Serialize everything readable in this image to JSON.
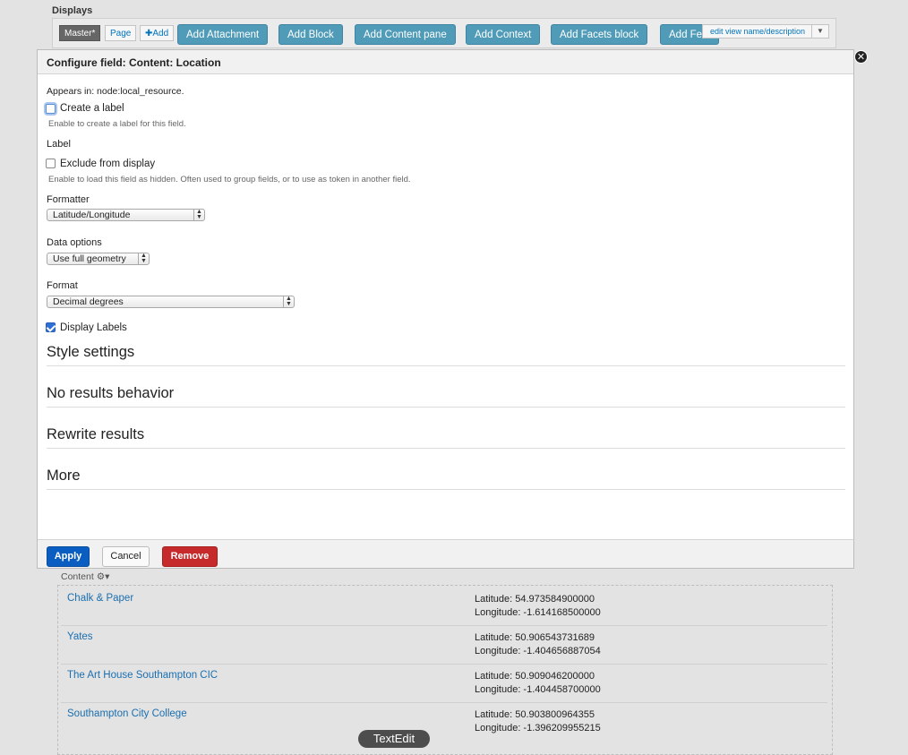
{
  "background": {
    "displays_title": "Displays",
    "tabs": [
      "Master*",
      "Page",
      "✚Add"
    ],
    "add_buttons": [
      "Add Attachment",
      "Add Block",
      "Add Content pane",
      "Add Context",
      "Add Facets block",
      "Add Fe"
    ],
    "edit_view_label": "edit view name/description",
    "content_label": "Content ⚙▾",
    "results": [
      {
        "name": "Chalk & Paper",
        "latitude": "Latitude: 54.973584900000",
        "longitude": "Longitude: -1.614168500000"
      },
      {
        "name": "Yates",
        "latitude": "Latitude: 50.906543731689",
        "longitude": "Longitude: -1.404656887054"
      },
      {
        "name": "The Art House Southampton CIC",
        "latitude": "Latitude: 50.909046200000",
        "longitude": "Longitude: -1.404458700000"
      },
      {
        "name": "Southampton City College",
        "latitude": "Latitude: 50.903800964355",
        "longitude": "Longitude: -1.396209955215"
      }
    ],
    "dock_label": "TextEdit"
  },
  "modal": {
    "title": "Configure field: Content: Location",
    "appears_in": "Appears in: node:local_resource.",
    "create_label": {
      "label": "Create a label",
      "checked": false,
      "description": "Enable to create a label for this field."
    },
    "label_heading": "Label",
    "exclude": {
      "label": "Exclude from display",
      "checked": false,
      "description": "Enable to load this field as hidden. Often used to group fields, or to use as token in another field."
    },
    "formatter": {
      "label": "Formatter",
      "value": "Latitude/Longitude"
    },
    "data_options": {
      "label": "Data options",
      "value": "Use full geometry"
    },
    "format": {
      "label": "Format",
      "value": "Decimal degrees"
    },
    "display_labels": {
      "label": "Display Labels",
      "checked": true
    },
    "sections": [
      "Style settings",
      "No results behavior",
      "Rewrite results",
      "More"
    ],
    "buttons": {
      "apply": "Apply",
      "cancel": "Cancel",
      "remove": "Remove"
    }
  }
}
